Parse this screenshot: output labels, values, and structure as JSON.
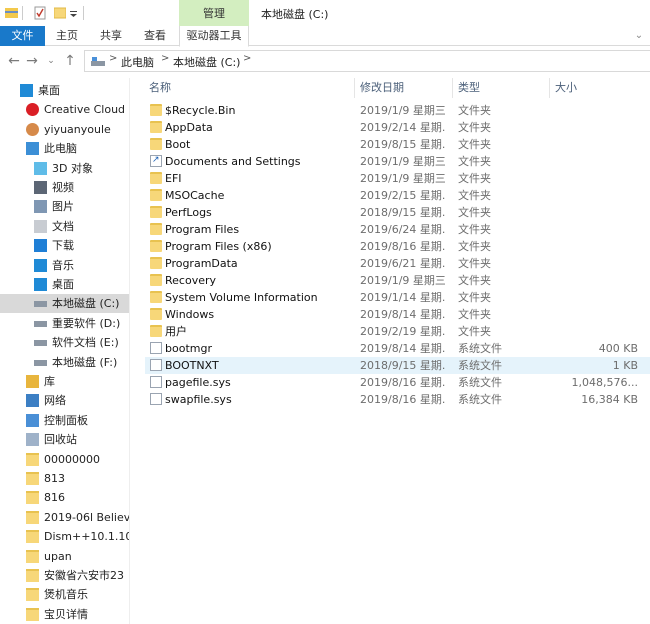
{
  "window": {
    "title": "本地磁盘 (C:)"
  },
  "ribbon": {
    "context_tab": "管理",
    "tabs": {
      "file": "文件",
      "home": "主页",
      "share": "共享",
      "view": "查看",
      "drive_tools": "驱动器工具"
    }
  },
  "address": {
    "crumbs": [
      "此电脑",
      "本地磁盘 (C:)"
    ],
    "separator": ">"
  },
  "columns": {
    "name": "名称",
    "date": "修改日期",
    "type": "类型",
    "size": "大小"
  },
  "nav": [
    {
      "label": "桌面",
      "icon": "desktop-blue-icon",
      "indent": 1
    },
    {
      "label": "Creative Cloud",
      "icon": "creative-cloud-icon",
      "indent": 2
    },
    {
      "label": "yiyuanyoule",
      "icon": "user-icon",
      "indent": 2
    },
    {
      "label": "此电脑",
      "icon": "this-pc-icon",
      "indent": 2
    },
    {
      "label": "3D 对象",
      "icon": "3d-objects-icon",
      "indent": 3
    },
    {
      "label": "视频",
      "icon": "video-icon",
      "indent": 3
    },
    {
      "label": "图片",
      "icon": "pictures-icon",
      "indent": 3
    },
    {
      "label": "文档",
      "icon": "documents-icon",
      "indent": 3
    },
    {
      "label": "下载",
      "icon": "downloads-icon",
      "indent": 3
    },
    {
      "label": "音乐",
      "icon": "music-icon",
      "indent": 3
    },
    {
      "label": "桌面",
      "icon": "desktop-icon",
      "indent": 3
    },
    {
      "label": "本地磁盘 (C:)",
      "icon": "drive-icon",
      "indent": 3,
      "selected": true
    },
    {
      "label": "重要软件 (D:)",
      "icon": "drive-icon",
      "indent": 3
    },
    {
      "label": "软件文档 (E:)",
      "icon": "drive-icon",
      "indent": 3
    },
    {
      "label": "本地磁盘 (F:)",
      "icon": "drive-icon",
      "indent": 3
    },
    {
      "label": "库",
      "icon": "library-icon",
      "indent": 2
    },
    {
      "label": "网络",
      "icon": "network-icon",
      "indent": 2
    },
    {
      "label": "控制面板",
      "icon": "control-panel-icon",
      "indent": 2
    },
    {
      "label": "回收站",
      "icon": "recycle-bin-icon",
      "indent": 2
    },
    {
      "label": "00000000",
      "icon": "folder-icon",
      "indent": 2
    },
    {
      "label": "813",
      "icon": "folder-icon",
      "indent": 2
    },
    {
      "label": "816",
      "icon": "folder-icon",
      "indent": 2
    },
    {
      "label": "2019-06l Believ",
      "icon": "folder-icon",
      "indent": 2
    },
    {
      "label": "Dism++10.1.10",
      "icon": "folder-icon",
      "indent": 2
    },
    {
      "label": "upan",
      "icon": "folder-icon",
      "indent": 2
    },
    {
      "label": "安徽省六安市23",
      "icon": "folder-icon",
      "indent": 2
    },
    {
      "label": "煲机音乐",
      "icon": "folder-icon",
      "indent": 2
    },
    {
      "label": "宝贝详情",
      "icon": "folder-icon",
      "indent": 2
    }
  ],
  "files": [
    {
      "name": "$Recycle.Bin",
      "date": "2019/1/9 星期三 ...",
      "type": "文件夹",
      "size": "",
      "icon": "folder-icon"
    },
    {
      "name": "AppData",
      "date": "2019/2/14 星期...",
      "type": "文件夹",
      "size": "",
      "icon": "folder-icon"
    },
    {
      "name": "Boot",
      "date": "2019/8/15 星期...",
      "type": "文件夹",
      "size": "",
      "icon": "folder-icon"
    },
    {
      "name": "Documents and Settings",
      "date": "2019/1/9 星期三 ...",
      "type": "文件夹",
      "size": "",
      "icon": "shortcut-folder-icon"
    },
    {
      "name": "EFI",
      "date": "2019/1/9 星期三 ...",
      "type": "文件夹",
      "size": "",
      "icon": "folder-icon"
    },
    {
      "name": "MSOCache",
      "date": "2019/2/15 星期...",
      "type": "文件夹",
      "size": "",
      "icon": "folder-icon"
    },
    {
      "name": "PerfLogs",
      "date": "2018/9/15 星期...",
      "type": "文件夹",
      "size": "",
      "icon": "folder-icon"
    },
    {
      "name": "Program Files",
      "date": "2019/6/24 星期...",
      "type": "文件夹",
      "size": "",
      "icon": "folder-icon"
    },
    {
      "name": "Program Files (x86)",
      "date": "2019/8/16 星期...",
      "type": "文件夹",
      "size": "",
      "icon": "folder-icon"
    },
    {
      "name": "ProgramData",
      "date": "2019/6/21 星期...",
      "type": "文件夹",
      "size": "",
      "icon": "folder-icon"
    },
    {
      "name": "Recovery",
      "date": "2019/1/9 星期三 ...",
      "type": "文件夹",
      "size": "",
      "icon": "folder-icon"
    },
    {
      "name": "System Volume Information",
      "date": "2019/1/14 星期...",
      "type": "文件夹",
      "size": "",
      "icon": "folder-icon"
    },
    {
      "name": "Windows",
      "date": "2019/8/14 星期...",
      "type": "文件夹",
      "size": "",
      "icon": "folder-icon"
    },
    {
      "name": "用户",
      "date": "2019/2/19 星期...",
      "type": "文件夹",
      "size": "",
      "icon": "folder-icon"
    },
    {
      "name": "bootmgr",
      "date": "2019/8/14 星期...",
      "type": "系统文件",
      "size": "400 KB",
      "icon": "system-file-icon"
    },
    {
      "name": "BOOTNXT",
      "date": "2018/9/15 星期...",
      "type": "系统文件",
      "size": "1 KB",
      "icon": "system-file-icon",
      "selected": true
    },
    {
      "name": "pagefile.sys",
      "date": "2019/8/16 星期...",
      "type": "系统文件",
      "size": "1,048,576...",
      "icon": "system-file-icon"
    },
    {
      "name": "swapfile.sys",
      "date": "2019/8/16 星期...",
      "type": "系统文件",
      "size": "16,384 KB",
      "icon": "system-file-icon"
    }
  ]
}
